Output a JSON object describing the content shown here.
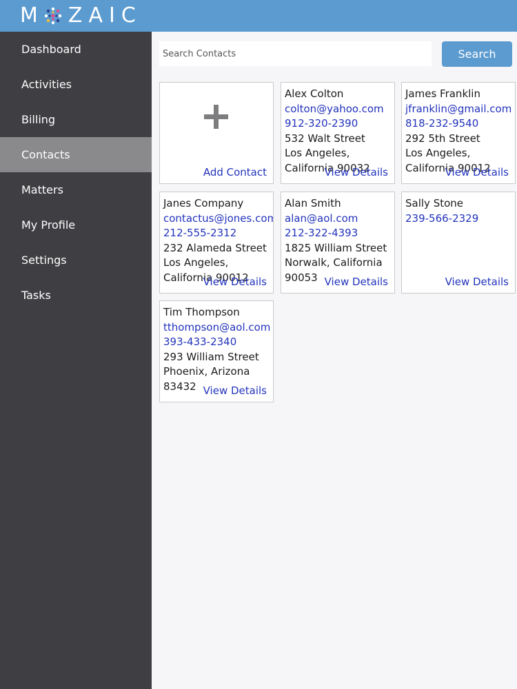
{
  "app": {
    "logo_text_start": "M",
    "logo_text_end": "ZAIC",
    "colors": {
      "header": "#5b9bd0",
      "sidebar": "#3f3e42",
      "sidebar_active": "#8a898c",
      "link": "#2233bb"
    }
  },
  "sidebar": {
    "items": [
      {
        "label": "Dashboard",
        "active": false
      },
      {
        "label": "Activities",
        "active": false
      },
      {
        "label": "Billing",
        "active": false
      },
      {
        "label": "Contacts",
        "active": true
      },
      {
        "label": "Matters",
        "active": false
      },
      {
        "label": "My Profile",
        "active": false
      },
      {
        "label": "Settings",
        "active": false
      },
      {
        "label": "Tasks",
        "active": false
      }
    ]
  },
  "search": {
    "placeholder": "Search Contacts",
    "value": "",
    "button_label": "Search"
  },
  "add_card": {
    "icon": "plus-icon",
    "label": "Add Contact"
  },
  "view_details_label": "View Details",
  "contacts": [
    {
      "name": "Alex Colton",
      "email": "colton@yahoo.com",
      "phone": "912-320-2390",
      "address": [
        "532 Walt Street",
        "Los Angeles,",
        "California 90032"
      ]
    },
    {
      "name": "James Franklin",
      "email": "jfranklin@gmail.com",
      "phone": "818-232-9540",
      "address": [
        "292 5th Street",
        "Los Angeles,",
        "California 90012"
      ]
    },
    {
      "name": "Janes Company",
      "email": "contactus@jones.com",
      "phone": "212-555-2312",
      "address": [
        "232 Alameda Street",
        "Los Angeles,",
        "California 90012"
      ]
    },
    {
      "name": "Alan Smith",
      "email": "alan@aol.com",
      "phone": "212-322-4393",
      "address": [
        "1825 William Street",
        "Norwalk, California",
        "90053"
      ]
    },
    {
      "name": "Sally Stone",
      "email": "",
      "phone": "239-566-2329",
      "address": []
    },
    {
      "name": "Tim Thompson",
      "email": "tthompson@aol.com",
      "phone": "393-433-2340",
      "address": [
        "293 William Street",
        "Phoenix, Arizona",
        "83432"
      ]
    }
  ]
}
